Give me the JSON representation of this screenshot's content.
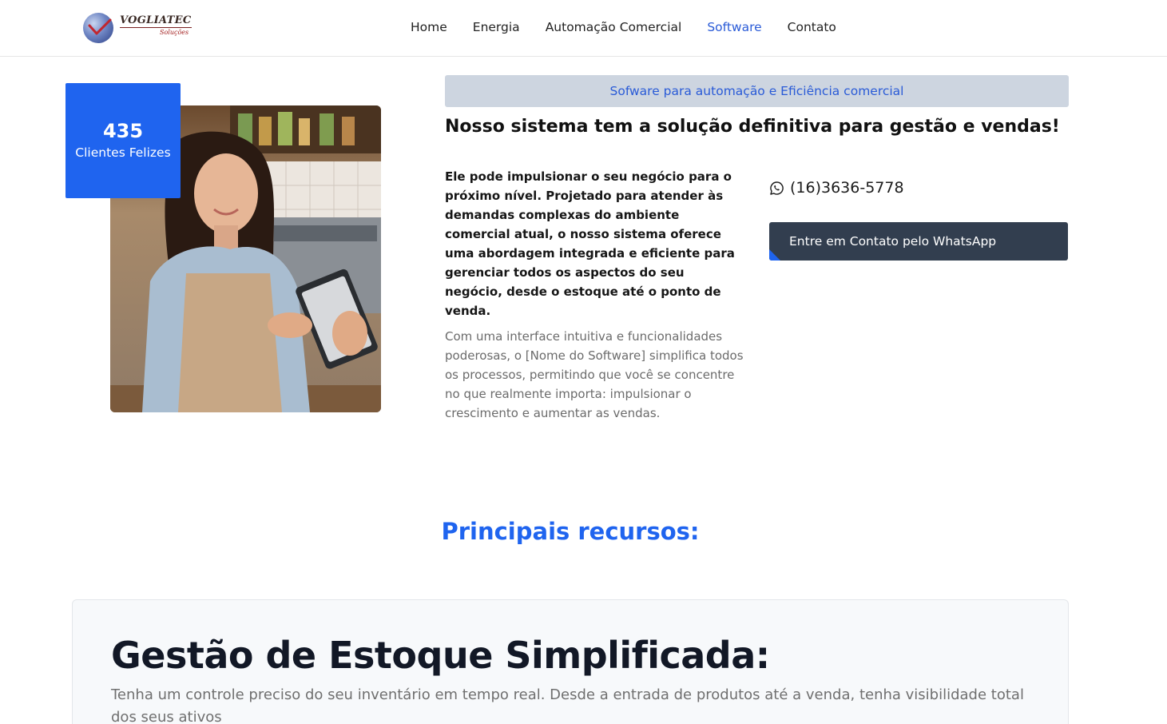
{
  "brand": {
    "name": "VOGLIATEC",
    "subtitle": "Soluções"
  },
  "nav": {
    "items": [
      {
        "label": "Home",
        "active": false
      },
      {
        "label": "Energia",
        "active": false
      },
      {
        "label": "Automação Comercial",
        "active": false
      },
      {
        "label": "Software",
        "active": true
      },
      {
        "label": "Contato",
        "active": false
      }
    ],
    "active_color": "#2a5bd7"
  },
  "counter": {
    "value": "435",
    "label": "Clientes Felizes",
    "color": "#1f64ef"
  },
  "hero": {
    "tagline": "Sofware para automação e Eficiência comercial",
    "headline": "Nosso sistema tem a solução definitiva para gestão e vendas!",
    "paragraph_bold": "Ele pode impulsionar o seu negócio para o próximo nível. Projetado para atender às demandas complexas do ambiente comercial atual, o nosso sistema oferece uma abordagem integrada e eficiente para gerenciar todos os aspectos do seu negócio, desde o estoque até o ponto de venda.",
    "paragraph_light": "Com uma interface intuitiva e funcionalidades poderosas, o [Nome do Software] simplifica todos os processos, permitindo que você se concentre no que realmente importa: impulsionar o crescimento e aumentar as vendas."
  },
  "contact": {
    "icon": "whatsapp-icon",
    "phone": "(16)3636-5778",
    "button_label": "Entre em Contato pelo WhatsApp",
    "button_color": "#323e4f"
  },
  "features": {
    "section_title": "Principais recursos:",
    "card": {
      "title": "Gestão de Estoque Simplificada:",
      "text": "Tenha um controle preciso do seu inventário em tempo real. Desde a entrada de produtos até a venda, tenha visibilidade total dos seus ativos"
    }
  }
}
